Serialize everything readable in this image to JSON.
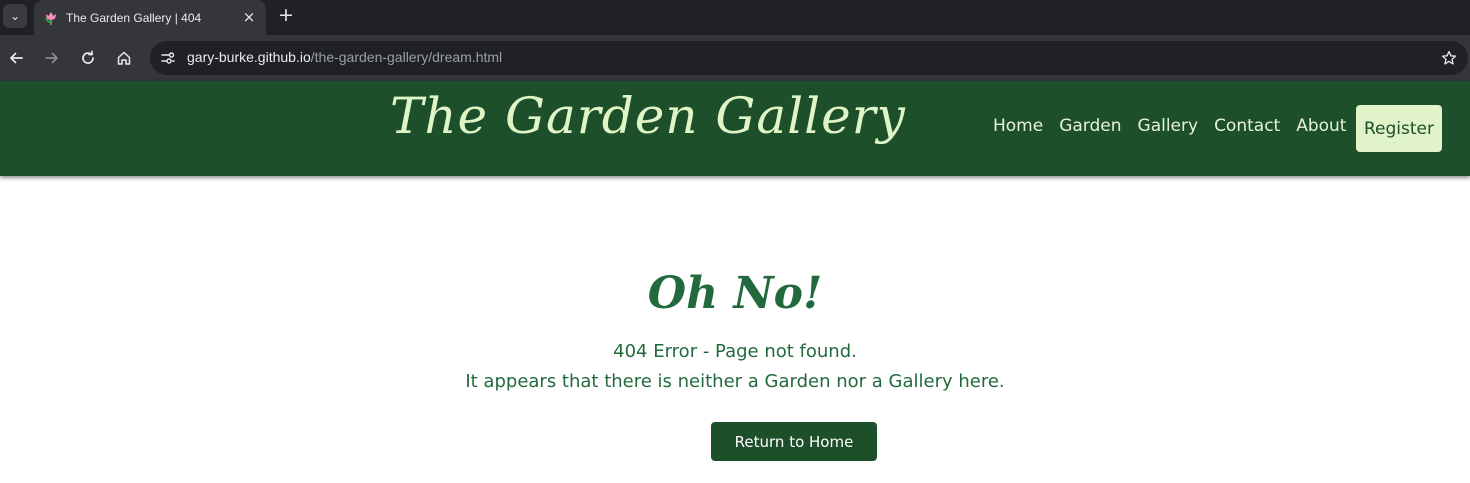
{
  "browser": {
    "tab": {
      "title": "The Garden Gallery | 404",
      "close_glyph": "×",
      "favicon": "tulip-icon"
    },
    "new_tab_glyph": "+",
    "tab_search_glyph": "⌄",
    "address": {
      "host": "gary-burke.github.io",
      "path": "/the-garden-gallery/dream.html"
    },
    "icons": [
      "back-arrow-icon",
      "forward-arrow-icon",
      "reload-icon",
      "home-icon",
      "site-info-icon",
      "star-icon"
    ]
  },
  "site": {
    "logo": "The Garden Gallery",
    "nav": [
      "Home",
      "Garden",
      "Gallery",
      "Contact",
      "About"
    ],
    "register_label": "Register"
  },
  "error": {
    "heading": "Oh No!",
    "line1": "404 Error - Page not found.",
    "line2": "It appears that there is neither a Garden nor a Gallery here.",
    "button_label": "Return to Home"
  },
  "colors": {
    "header_bg": "#1d4f2b",
    "logo_text": "#dff5c5",
    "register_bg": "#e0f3c9",
    "content_text": "#226a3d",
    "button_bg": "#1d4f2b"
  }
}
